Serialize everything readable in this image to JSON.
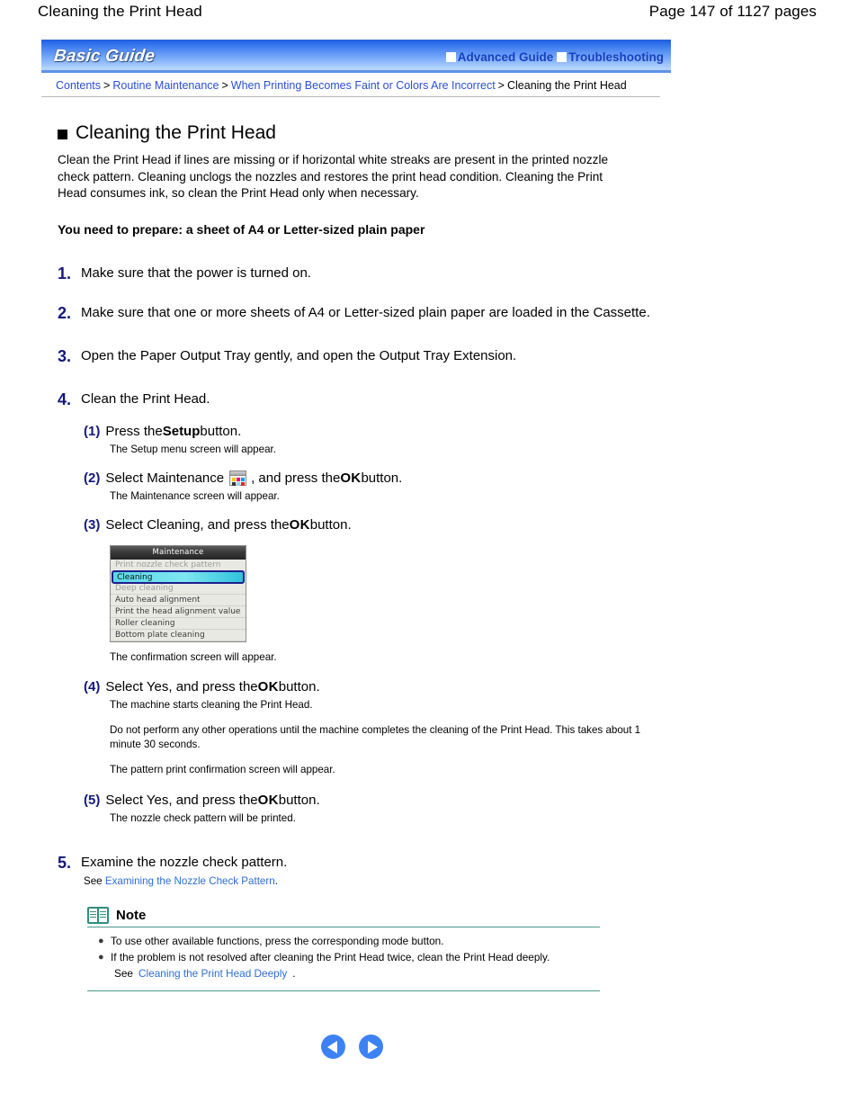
{
  "page_header": {
    "title": "Cleaning the Print Head",
    "page_label": "Page 147 of 1127 pages"
  },
  "guide_bar": {
    "brand": "Basic Guide",
    "links": [
      {
        "label": "Advanced Guide"
      },
      {
        "label": "Troubleshooting"
      }
    ]
  },
  "breadcrumb": {
    "items": [
      {
        "label": "Contents",
        "link": true
      },
      {
        "label": "Routine Maintenance",
        "link": true
      },
      {
        "label": "When Printing Becomes Faint or Colors Are Incorrect",
        "link": true
      },
      {
        "label": "Cleaning the Print Head",
        "link": false
      }
    ],
    "separator": ">"
  },
  "doc": {
    "title": "Cleaning the Print Head",
    "intro": "Clean the Print Head if lines are missing or if horizontal white streaks are present in the printed nozzle check pattern. Cleaning unclogs the nozzles and restores the print head condition. Cleaning the Print Head consumes ink, so clean the Print Head only when necessary.",
    "prepare": "You need to prepare: a sheet of A4 or Letter-sized plain paper"
  },
  "steps": {
    "s1": {
      "num": "1.",
      "text": "Make sure that the power is turned on."
    },
    "s2": {
      "num": "2.",
      "text": "Make sure that one or more sheets of A4 or Letter-sized plain paper are loaded in the Cassette."
    },
    "s3": {
      "num": "3.",
      "text": "Open the Paper Output Tray gently, and open the Output Tray Extension."
    },
    "s4": {
      "num": "4.",
      "text": "Clean the Print Head."
    },
    "s5": {
      "num": "5.",
      "text": "Examine the nozzle check pattern."
    }
  },
  "substeps": {
    "n1": {
      "num": "(1)",
      "pre": "Press the ",
      "bold": "Setup",
      "post": " button.",
      "note": "The Setup menu screen will appear."
    },
    "n2": {
      "num": "(2)",
      "pre": "Select Maintenance",
      "mid": ", and press the ",
      "ok": "OK",
      "post": " button.",
      "note": "The Maintenance screen will appear."
    },
    "n3": {
      "num": "(3)",
      "pre": "Select Cleaning, and press the ",
      "ok": "OK",
      "post": " button.",
      "caption": "The confirmation screen will appear."
    },
    "n4": {
      "num": "(4)",
      "pre": "Select Yes, and press the ",
      "ok": "OK",
      "post": " button.",
      "note": "The machine starts cleaning the Print Head.",
      "para1": "Do not perform any other operations until the machine completes the cleaning of the Print Head. This takes about 1 minute 30 seconds.",
      "para2": "The pattern print confirmation screen will appear."
    },
    "n5": {
      "num": "(5)",
      "pre": "Select Yes, and press the ",
      "ok": "OK",
      "post": " button.",
      "note": "The nozzle check pattern will be printed."
    }
  },
  "see_line": {
    "prefix": "See ",
    "link": "Examining the Nozzle Check Pattern",
    "suffix": "."
  },
  "lcd": {
    "title": "Maintenance",
    "items": [
      {
        "label": "Print nozzle check pattern",
        "state": "faded"
      },
      {
        "label": "Cleaning",
        "state": "selected"
      },
      {
        "label": "Deep cleaning",
        "state": "faded"
      },
      {
        "label": "Auto head alignment",
        "state": "normal"
      },
      {
        "label": "Print the head alignment value",
        "state": "normal"
      },
      {
        "label": "Roller cleaning",
        "state": "normal"
      },
      {
        "label": "Bottom plate cleaning",
        "state": "normal"
      }
    ]
  },
  "note": {
    "heading": "Note",
    "bullets": [
      {
        "text": "To use other available functions, press the corresponding mode button."
      },
      {
        "text": "If the problem is not resolved after cleaning the Print Head twice, clean the Print Head deeply."
      }
    ],
    "sub_see_prefix": "See ",
    "sub_see_link": "Cleaning the Print Head Deeply",
    "sub_see_suffix": "."
  },
  "nav": {
    "prev_label": "previous-page",
    "next_label": "next-page"
  },
  "colors": {
    "step_number": "#13197a",
    "link": "#2b4fd4",
    "note_rule": "#4f9c8b",
    "banner_blue": "#1f63e8",
    "arrow_blue": "#3d82f5"
  }
}
